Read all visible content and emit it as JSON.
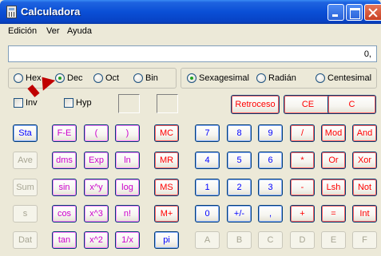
{
  "window": {
    "title": "Calculadora"
  },
  "menu": [
    "Edición",
    "Ver",
    "Ayuda"
  ],
  "display": {
    "value": "0,"
  },
  "base_group": [
    {
      "label": "Hex",
      "checked": false
    },
    {
      "label": "Dec",
      "checked": true
    },
    {
      "label": "Oct",
      "checked": false
    },
    {
      "label": "Bin",
      "checked": false
    }
  ],
  "angle_group": [
    {
      "label": "Sexagesimal",
      "checked": true
    },
    {
      "label": "Radián",
      "checked": false
    },
    {
      "label": "Centesimal",
      "checked": false
    }
  ],
  "checks": {
    "inv": "Inv",
    "hyp": "Hyp"
  },
  "edit_buttons": {
    "backspace": "Retroceso",
    "ce": "CE",
    "c": "C"
  },
  "stats_buttons": [
    "Sta",
    "Ave",
    "Sum",
    "s",
    "Dat"
  ],
  "sci_col1": [
    "F-E",
    "dms",
    "sin",
    "cos",
    "tan"
  ],
  "sci_col2": [
    "(",
    "Exp",
    "x^y",
    "x^3",
    "x^2"
  ],
  "sci_col3": [
    ")",
    "ln",
    "log",
    "n!",
    "1/x"
  ],
  "mem_buttons": [
    "MC",
    "MR",
    "MS",
    "M+",
    "pi"
  ],
  "digits_row1": [
    "7",
    "8",
    "9",
    "/",
    "Mod",
    "And"
  ],
  "digits_row2": [
    "4",
    "5",
    "6",
    "*",
    "Or",
    "Xor"
  ],
  "digits_row3": [
    "1",
    "2",
    "3",
    "-",
    "Lsh",
    "Not"
  ],
  "digits_row4": [
    "0",
    "+/-",
    ",",
    "+",
    "=",
    "Int"
  ],
  "hex_row": [
    "A",
    "B",
    "C",
    "D",
    "E",
    "F"
  ]
}
